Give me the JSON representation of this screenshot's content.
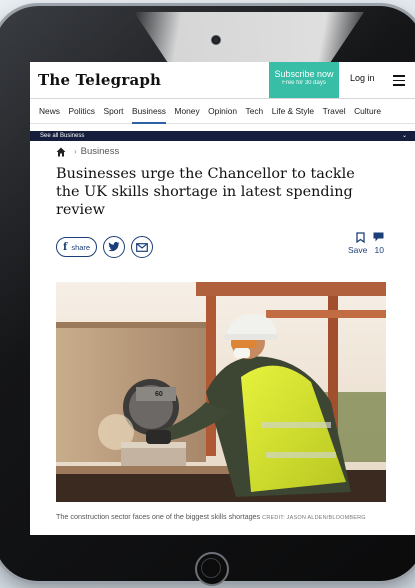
{
  "header": {
    "logo": "The Telegraph",
    "subscribe_label": "Subscribe now",
    "subscribe_sub": "Free for 30 days",
    "login_label": "Log in"
  },
  "nav": {
    "items": [
      {
        "label": "News"
      },
      {
        "label": "Politics"
      },
      {
        "label": "Sport"
      },
      {
        "label": "Business",
        "active": true
      },
      {
        "label": "Money"
      },
      {
        "label": "Opinion"
      },
      {
        "label": "Tech"
      },
      {
        "label": "Life & Style"
      },
      {
        "label": "Travel"
      },
      {
        "label": "Culture"
      }
    ],
    "see_all": "See all Business"
  },
  "article": {
    "breadcrumb_section": "Business",
    "headline": "Businesses urge the Chancellor to tackle the UK skills shortage in latest spending review",
    "share_label": "share",
    "save_label": "Save",
    "comment_count": "10",
    "caption": "The construction sector faces one of the biggest skills shortages",
    "credit": "CREDIT: JASON ALDEN/BLOOMBERG"
  },
  "colors": {
    "accent": "#38bea6",
    "brand_blue": "#1c3f78",
    "nav_underline": "#2b62a6",
    "see_all_bg": "#151e3c"
  }
}
